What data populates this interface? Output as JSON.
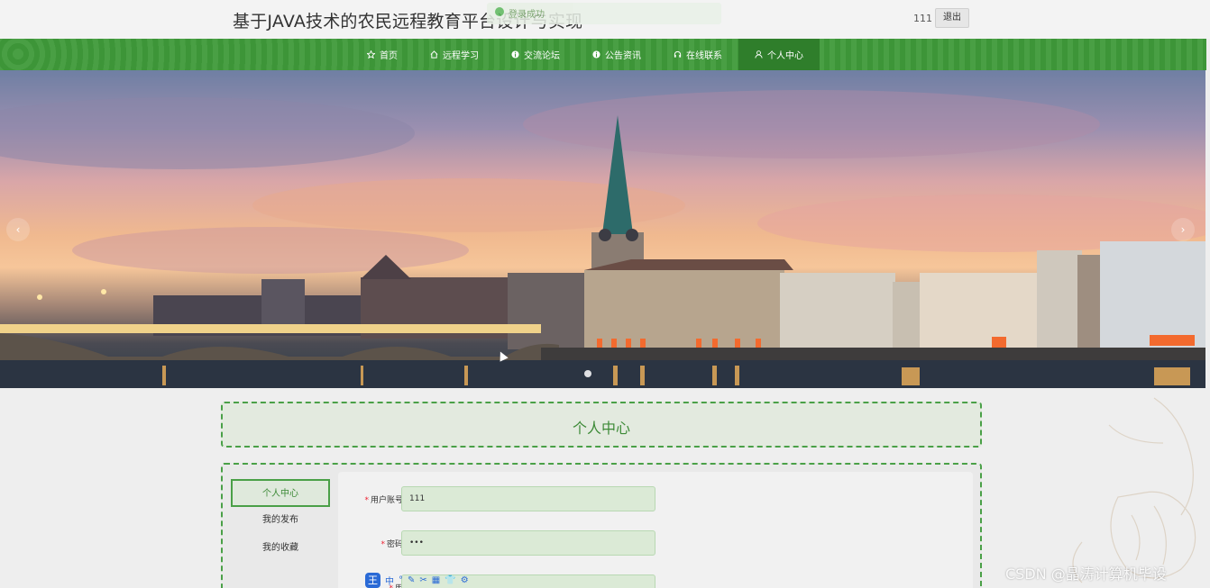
{
  "header": {
    "site_title": "基于JAVA技术的农民远程教育平台设计与实现",
    "toast_text": "登录成功",
    "username": "111",
    "logout_label": "退出"
  },
  "nav": {
    "items": [
      {
        "label": "首页",
        "icon": "star-icon"
      },
      {
        "label": "远程学习",
        "icon": "home-icon"
      },
      {
        "label": "交流论坛",
        "icon": "info-icon"
      },
      {
        "label": "公告资讯",
        "icon": "info-icon"
      },
      {
        "label": "在线联系",
        "icon": "headset-icon"
      },
      {
        "label": "个人中心",
        "icon": "user-icon"
      }
    ],
    "active_index": 5
  },
  "banner": {
    "prev_label": "‹",
    "next_label": "›",
    "slide_count": 1,
    "active_slide": 0
  },
  "page": {
    "title": "个人中心"
  },
  "side_menu": {
    "items": [
      "个人中心",
      "我的发布",
      "我的收藏"
    ],
    "active_index": 0
  },
  "form": {
    "fields": [
      {
        "label": "用户账号",
        "value": "111",
        "required": true
      },
      {
        "label": "密码",
        "value": "•••",
        "required": true
      },
      {
        "label": "用",
        "value": "",
        "required": true
      }
    ]
  },
  "ime_toolbar": {
    "logo": "王",
    "items": [
      "中",
      "°",
      "✎",
      "✂",
      "▦",
      "👕",
      "⚙"
    ]
  },
  "watermark": "CSDN @晶涛计算机毕设",
  "colors": {
    "primary_green": "#3f9a3a",
    "active_green": "#2f7e2b",
    "panel_border": "#4aa047"
  }
}
